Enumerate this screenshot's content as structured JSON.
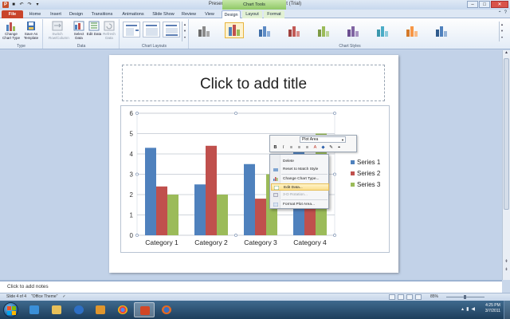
{
  "window": {
    "title": "Presentation2 - Microsoft PowerPoint (Trial)",
    "context_tools": "Chart Tools",
    "buttons": {
      "minimize": "–",
      "maximize": "□",
      "close": "✕"
    }
  },
  "tabs": [
    {
      "label": "File"
    },
    {
      "label": "Home"
    },
    {
      "label": "Insert"
    },
    {
      "label": "Design"
    },
    {
      "label": "Transitions"
    },
    {
      "label": "Animations"
    },
    {
      "label": "Slide Show"
    },
    {
      "label": "Review"
    },
    {
      "label": "View"
    },
    {
      "label": "Design"
    },
    {
      "label": "Layout"
    },
    {
      "label": "Format"
    }
  ],
  "ribbon": {
    "groups": {
      "type": "Type",
      "data": "Data",
      "chart_layouts": "Chart Layouts",
      "chart_styles": "Chart Styles"
    },
    "buttons": {
      "change_chart_type": "Change Chart Type",
      "save_as_template": "Save As Template",
      "switch_row_column": "Switch Row/Column",
      "select_data": "Select Data",
      "edit_data": "Edit Data",
      "refresh_data": "Refresh Data"
    }
  },
  "slide": {
    "title_placeholder": "Click to add title"
  },
  "chart_data": {
    "type": "bar",
    "categories": [
      "Category 1",
      "Category 2",
      "Category 3",
      "Category 4"
    ],
    "series": [
      {
        "name": "Series 1",
        "color": "#4f81bd",
        "values": [
          4.3,
          2.5,
          3.5,
          4.5
        ]
      },
      {
        "name": "Series 2",
        "color": "#c0504d",
        "values": [
          2.4,
          4.4,
          1.8,
          2.8
        ]
      },
      {
        "name": "Series 3",
        "color": "#9bbb59",
        "values": [
          2.0,
          2.0,
          3.0,
          5.0
        ]
      }
    ],
    "y_ticks": [
      "0",
      "1",
      "2",
      "3",
      "4",
      "5",
      "6"
    ],
    "ylim": [
      0,
      6
    ],
    "grid": true,
    "legend_position": "right"
  },
  "minibar": {
    "selector_value": "Plot Area",
    "buttons": [
      "B",
      "I",
      "≡",
      "≡",
      "≡",
      "A",
      "◆",
      "✎",
      "⌖"
    ]
  },
  "context_menu": {
    "items": [
      {
        "label": "Delete",
        "enabled": true
      },
      {
        "label": "Reset to Match Style",
        "enabled": true
      },
      {
        "label": "Change Chart Type...",
        "enabled": true
      },
      {
        "label": "Edit Data...",
        "enabled": true,
        "highlighted": true
      },
      {
        "label": "3-D Rotation...",
        "enabled": false
      },
      {
        "label": "Format Plot Area...",
        "enabled": true
      }
    ]
  },
  "notes": {
    "placeholder": "Click to add notes"
  },
  "status": {
    "slide_info": "Slide 4 of 4",
    "theme": "\"Office Theme\"",
    "zoom": "85%"
  },
  "taskbar": {
    "time": "4:25 PM",
    "date": "3/7/2011"
  },
  "colors": {
    "accent_file_tab": "#c9442b",
    "context_tab": "#8fc866",
    "menu_highlight": "#fbdf8e"
  }
}
